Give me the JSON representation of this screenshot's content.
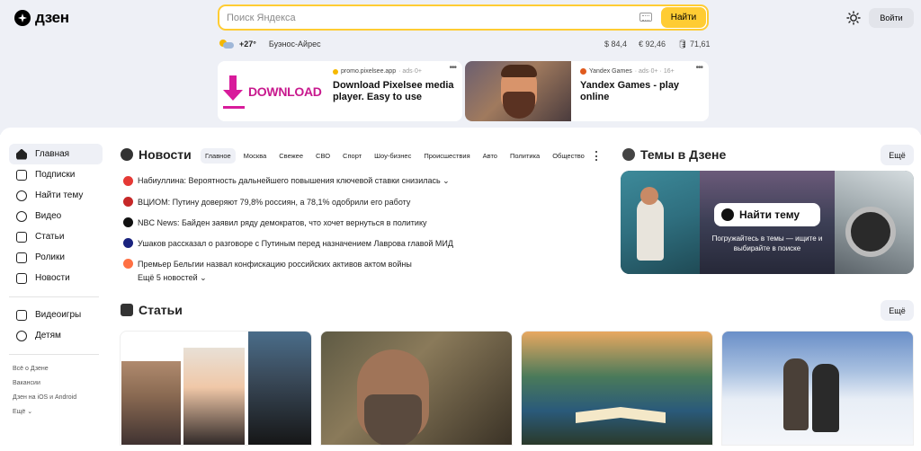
{
  "header": {
    "logo_text": "дзен",
    "search_placeholder": "Поиск Яндекса",
    "search_button": "Найти",
    "login_button": "Войти"
  },
  "weather": {
    "temp": "+27°",
    "city": "Буэнос-Айрес"
  },
  "rates": [
    "$ 84,4",
    "€ 92,46",
    "🛢 71,61"
  ],
  "ads": [
    {
      "image_text": "DOWNLOAD",
      "source": "promo.pixelsee.app",
      "source_meta": "· ads·0+",
      "title": "Download Pixelsee media player. Easy to use"
    },
    {
      "source": "Yandex Games",
      "source_meta": "· ads·0+ · 16+",
      "title": "Yandex Games - play online"
    }
  ],
  "sidebar": {
    "items": [
      {
        "label": "Главная",
        "icon": "home-icon"
      },
      {
        "label": "Подписки",
        "icon": "subscriptions-icon"
      },
      {
        "label": "Найти тему",
        "icon": "compass-icon"
      },
      {
        "label": "Видео",
        "icon": "video-icon"
      },
      {
        "label": "Статьи",
        "icon": "articles-icon"
      },
      {
        "label": "Ролики",
        "icon": "shorts-icon"
      },
      {
        "label": "Новости",
        "icon": "news-icon"
      }
    ],
    "items2": [
      {
        "label": "Видеоигры",
        "icon": "gamepad-icon"
      },
      {
        "label": "Детям",
        "icon": "kids-icon"
      }
    ],
    "footer": [
      "Всё о Дзене",
      "Вакансии",
      "Дзен на iOS и Android",
      "Ещё ⌄"
    ]
  },
  "news": {
    "title": "Новости",
    "tabs": [
      "Главное",
      "Москва",
      "Свежее",
      "СВО",
      "Спорт",
      "Шоу-бизнес",
      "Происшествия",
      "Авто",
      "Политика",
      "Общество"
    ],
    "items": [
      {
        "text": "Набиуллина: Вероятность дальнейшего повышения ключевой ставки снизилась ⌄",
        "color": "#e53935"
      },
      {
        "text": "ВЦИОМ: Путину доверяют 79,8% россиян, а 78,1% одобрили его работу",
        "color": "#c62828"
      },
      {
        "text": "NBC News: Байден заявил ряду демократов, что хочет вернуться в политику",
        "color": "#111111"
      },
      {
        "text": "Ушаков рассказал о разговоре с Путиным перед назначением Лаврова главой МИД",
        "color": "#1a237e"
      },
      {
        "text": "Премьер Бельгии назвал конфискацию российских активов актом войны",
        "color": "#ff7043"
      }
    ],
    "more": "Ещё 5 новостей ⌄"
  },
  "topics": {
    "title": "Темы в Дзене",
    "more_button": "Ещё",
    "banner_button": "Найти тему",
    "banner_text": "Погружайтесь в темы — ищите и выбирайте в поиске"
  },
  "articles": {
    "title": "Статьи",
    "more_button": "Ещё"
  }
}
